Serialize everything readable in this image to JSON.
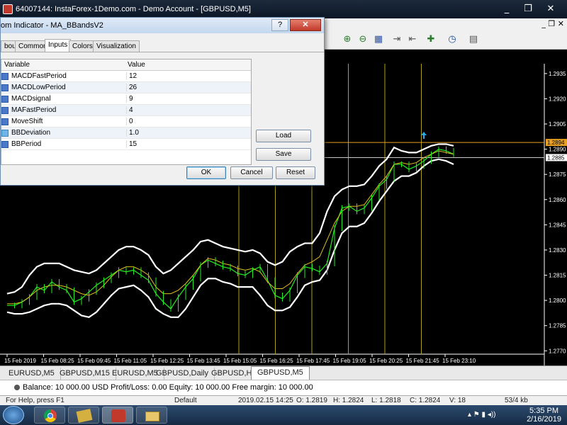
{
  "window": {
    "title": "64007144: InstaForex-1Demo.com - Demo Account - [GBPUSD,M5]",
    "minimize": "_",
    "restore": "❐",
    "close": "✕"
  },
  "dialog": {
    "title": "om Indicator - MA_BBandsV2",
    "help_button": "?",
    "close_button": "✕",
    "tabs": [
      "bout",
      "Common",
      "Inputs",
      "Colors",
      "Visualization"
    ],
    "active_tab": "Inputs",
    "grid_headers": {
      "variable": "Variable",
      "value": "Value"
    },
    "params": [
      {
        "icon": "int",
        "name": "MACDFastPeriod",
        "value": "12"
      },
      {
        "icon": "int",
        "name": "MACDLowPeriod",
        "value": "26"
      },
      {
        "icon": "int",
        "name": "MACDsignal",
        "value": "9"
      },
      {
        "icon": "int",
        "name": "MAFastPeriod",
        "value": "4"
      },
      {
        "icon": "int",
        "name": "MoveShift",
        "value": "0"
      },
      {
        "icon": "dbl",
        "name": "BBDeviation",
        "value": "1.0"
      },
      {
        "icon": "int",
        "name": "BBPeriod",
        "value": "15"
      }
    ],
    "buttons": {
      "load": "Load",
      "save": "Save",
      "ok": "OK",
      "cancel": "Cancel",
      "reset": "Reset"
    }
  },
  "chart_data": {
    "type": "line",
    "symbol": "GBPUSD,M5",
    "price_ticks": [
      "1.2935",
      "1.2920",
      "1.2905",
      "1.2890",
      "1.2875",
      "1.2860",
      "1.2845",
      "1.2830",
      "1.2815",
      "1.2800",
      "1.2785",
      "1.2770"
    ],
    "price_markers": [
      {
        "label": "1.2894"
      },
      {
        "label": "1.2885"
      }
    ],
    "time_ticks": [
      "15 Feb 2019",
      "15 Feb 08:25",
      "15 Feb 09:45",
      "15 Feb 11:05",
      "15 Feb 12:25",
      "15 Feb 13:45",
      "15 Feb 15:05",
      "15 Feb 16:25",
      "15 Feb 17:45",
      "15 Feb 19:05",
      "15 Feb 20:25",
      "15 Feb 21:45",
      "15 Feb 23:10"
    ],
    "ylim": [
      1.2768,
      1.294
    ],
    "series": [
      {
        "name": "close",
        "color": "#22ee22",
        "values": [
          1.2797,
          1.2797,
          1.2799,
          1.2802,
          1.2808,
          1.2806,
          1.2811,
          1.2808,
          1.2806,
          1.2799,
          1.2801,
          1.2805,
          1.2809,
          1.2812,
          1.2815,
          1.2818,
          1.2817,
          1.2818,
          1.2815,
          1.2812,
          1.2804,
          1.2799,
          1.2795,
          1.2802,
          1.2808,
          1.2813,
          1.2821,
          1.2824,
          1.2822,
          1.282,
          1.2819,
          1.2816,
          1.2815,
          1.2818,
          1.282,
          1.2812,
          1.2803,
          1.2801,
          1.2806,
          1.2815,
          1.282,
          1.2819,
          1.2817,
          1.2822,
          1.2843,
          1.2855,
          1.2856,
          1.2853,
          1.2855,
          1.2861,
          1.2868,
          1.2872,
          1.2881,
          1.2881,
          1.2878,
          1.288,
          1.2883,
          1.2887,
          1.289,
          1.2889,
          1.2887
        ]
      },
      {
        "name": "upper band",
        "color": "#ffffff",
        "values": [
          1.2804,
          1.2805,
          1.2808,
          1.2815,
          1.282,
          1.2822,
          1.2822,
          1.2822,
          1.282,
          1.2818,
          1.2817,
          1.2816,
          1.2818,
          1.2822,
          1.2826,
          1.283,
          1.2832,
          1.2832,
          1.283,
          1.2827,
          1.282,
          1.2816,
          1.2818,
          1.2822,
          1.2826,
          1.283,
          1.2835,
          1.2836,
          1.2834,
          1.2832,
          1.2831,
          1.283,
          1.2829,
          1.283,
          1.2828,
          1.2823,
          1.2821,
          1.2823,
          1.2829,
          1.2832,
          1.2834,
          1.2834,
          1.284,
          1.2853,
          1.2862,
          1.2866,
          1.2868,
          1.2868,
          1.2869,
          1.2874,
          1.288,
          1.2884,
          1.2891,
          1.2889,
          1.2888,
          1.2888,
          1.289,
          1.2892,
          1.2893,
          1.2893,
          1.2892
        ]
      },
      {
        "name": "lower band",
        "color": "#ffffff",
        "values": [
          1.2793,
          1.2792,
          1.2792,
          1.2793,
          1.2795,
          1.2797,
          1.2798,
          1.2798,
          1.2797,
          1.2794,
          1.2791,
          1.279,
          1.2793,
          1.2798,
          1.2803,
          1.2807,
          1.2808,
          1.2809,
          1.2806,
          1.2802,
          1.2795,
          1.2792,
          1.279,
          1.279,
          1.2795,
          1.2802,
          1.2809,
          1.2813,
          1.2813,
          1.2811,
          1.281,
          1.2808,
          1.2808,
          1.2808,
          1.2803,
          1.2797,
          1.2794,
          1.2794,
          1.2796,
          1.2802,
          1.2809,
          1.2811,
          1.2812,
          1.2818,
          1.283,
          1.284,
          1.2844,
          1.2844,
          1.2846,
          1.2852,
          1.2859,
          1.2865,
          1.2871,
          1.2874,
          1.2874,
          1.2876,
          1.288,
          1.2883,
          1.2884,
          1.2883,
          1.2881
        ]
      },
      {
        "name": "moving average",
        "color": "#e0c020",
        "values": [
          1.2798,
          1.2798,
          1.2799,
          1.2802,
          1.2806,
          1.2808,
          1.2809,
          1.2809,
          1.2808,
          1.2806,
          1.2804,
          1.2803,
          1.2805,
          1.2809,
          1.2814,
          1.2818,
          1.282,
          1.282,
          1.2818,
          1.2815,
          1.2808,
          1.2804,
          1.2804,
          1.2806,
          1.281,
          1.2815,
          1.2821,
          1.2825,
          1.2824,
          1.2822,
          1.2821,
          1.2819,
          1.2818,
          1.2819,
          1.2817,
          1.2811,
          1.2807,
          1.2807,
          1.281,
          1.2816,
          1.2821,
          1.2823,
          1.2826,
          1.2836,
          1.2846,
          1.2853,
          1.2856,
          1.2856,
          1.2857,
          1.2863,
          1.2869,
          1.2874,
          1.2881,
          1.2882,
          1.2881,
          1.2882,
          1.2885,
          1.2887,
          1.2889,
          1.2888,
          1.2887
        ]
      }
    ],
    "vertical_line_times": [
      "15 Feb 15:05",
      "15 Feb 16:25",
      "15 Feb 17:45",
      "15 Feb 19:05",
      "15 Feb 20:25",
      "15 Feb 21:45"
    ],
    "grid": false
  },
  "tabs": [
    "EURUSD,M5",
    "GBPUSD,M15",
    "EURUSD,M5",
    "GBPUSD,Daily",
    "GBPUSD,H4",
    "GBPUSD,M5"
  ],
  "active_tab": "GBPUSD,M5",
  "account": {
    "text": "Balance: 10 000.00 USD  Profit/Loss: 0.00  Equity: 10 000.00  Free margin: 10 000.00"
  },
  "status": {
    "help": "For Help, press F1",
    "profile": "Default",
    "time": "2019.02.15 14:25",
    "open": "O: 1.2819",
    "high": "H: 1.2824",
    "low": "L: 1.2818",
    "close": "C: 1.2824",
    "volume": "V: 18",
    "traffic": "53/4 kb"
  },
  "taskbar": {
    "time": "5:35 PM",
    "date": "2/16/2019"
  },
  "colors": {
    "background": "#000000",
    "price_line": "#22ee22",
    "bands": "#ffffff",
    "ma": "#e0c020",
    "vline": "#b0a010",
    "bid_marker": "#e8a020"
  }
}
